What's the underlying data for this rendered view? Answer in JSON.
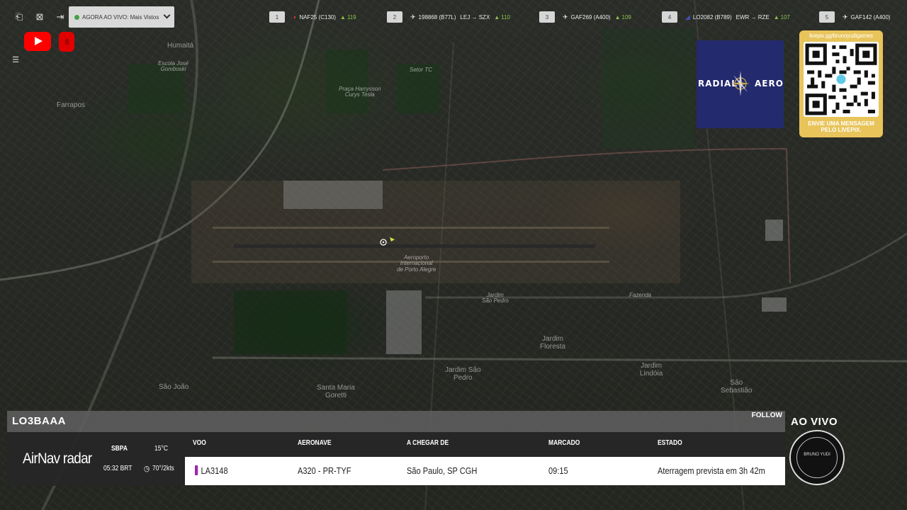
{
  "topbar": {
    "now_playing": "AGORA AO VIVO: Mais Vistos",
    "flights": [
      {
        "rank": "1",
        "callsign": "NAF25 (C130)",
        "route": "",
        "altitude": "119",
        "flag": "flag-icon"
      },
      {
        "rank": "2",
        "callsign": "198868 (B77L)",
        "route": "LEJ → SZX",
        "altitude": "110",
        "flag": ""
      },
      {
        "rank": "3",
        "callsign": "GAF269 (A400)",
        "route": "",
        "altitude": "109",
        "flag": ""
      },
      {
        "rank": "4",
        "callsign": "LO2082 (B789)",
        "route": "EWR → RZE",
        "altitude": "107",
        "flag": ""
      },
      {
        "rank": "5",
        "callsign": "GAF142 (A400)",
        "route": "",
        "altitude": "",
        "flag": ""
      }
    ]
  },
  "map": {
    "labels": [
      {
        "text": "Humaitá",
        "cls": "big"
      },
      {
        "text": "Escola José\nGomboski",
        "cls": ""
      },
      {
        "text": "Farrapos",
        "cls": "big"
      },
      {
        "text": "Praça Harrysson\nCurys Tesla",
        "cls": ""
      },
      {
        "text": "Setor TC",
        "cls": ""
      },
      {
        "text": "Aeroporto\nInternacional\nde Porto Alegre",
        "cls": ""
      },
      {
        "text": "Jardim\nSão Pedro",
        "cls": ""
      },
      {
        "text": "Jardim\nFloresta",
        "cls": "big"
      },
      {
        "text": "Jardim São\nPedro",
        "cls": "big"
      },
      {
        "text": "Santa Maria\nGoretti",
        "cls": "big"
      },
      {
        "text": "Jardim\nLindóia",
        "cls": "big"
      },
      {
        "text": "São\nSebastião",
        "cls": "big"
      },
      {
        "text": "São João",
        "cls": "big"
      },
      {
        "text": "Fazenda",
        "cls": ""
      }
    ]
  },
  "sponsor": {
    "radial_left": "RADIAL",
    "radial_right": "AERO"
  },
  "livepix": {
    "url": "livepix.gg/brunoyudigames",
    "caption_1": "ENVIE UMA MENSAGEM",
    "caption_2": "PELO LIVEPIX."
  },
  "flight_panel": {
    "registration": "LO3BAAA",
    "follow_label": "FOLLOW",
    "brand": "AirNav radar",
    "airport": "SBPA",
    "temperature": "15°C",
    "local_time": "05:32 BRT",
    "wind": "70°/2kts",
    "headers": {
      "flight": "VOO",
      "aircraft": "AERONAVE",
      "arriving_from": "A CHEGAR DE",
      "scheduled": "MARCADO",
      "status": "ESTADO"
    },
    "row": {
      "flight": "LA3148",
      "aircraft": "A320 - PR-TYF",
      "arriving_from": "São Paulo, SP CGH",
      "scheduled": "09:15",
      "status": "Aterragem prevista em 3h 42m"
    }
  },
  "live": {
    "label": "AO VIVO",
    "badge_text": "BRUNO YUDI"
  }
}
